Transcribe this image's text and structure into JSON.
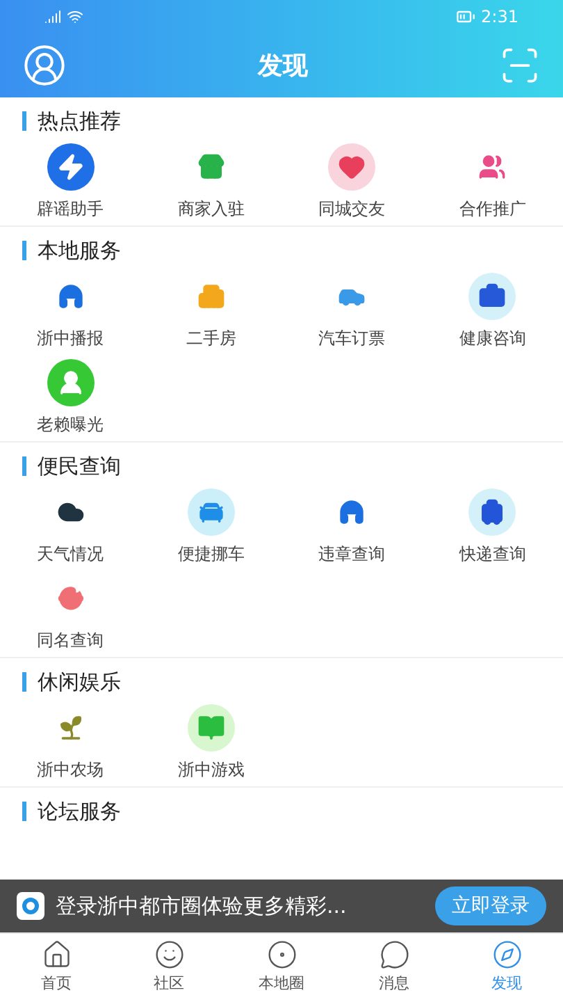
{
  "status_bar": {
    "time": "2:31"
  },
  "header": {
    "title": "发现"
  },
  "sections": [
    {
      "title": "热点推荐",
      "items": [
        "辟谣助手",
        "商家入驻",
        "同城交友",
        "合作推广"
      ]
    },
    {
      "title": "本地服务",
      "items": [
        "浙中播报",
        "二手房",
        "汽车订票",
        "健康咨询",
        "老赖曝光"
      ]
    },
    {
      "title": "便民查询",
      "items": [
        "天气情况",
        "便捷挪车",
        "违章查询",
        "快递查询",
        "同名查询"
      ]
    },
    {
      "title": "休闲娱乐",
      "items": [
        "浙中农场",
        "浙中游戏"
      ]
    },
    {
      "title": "论坛服务"
    }
  ],
  "login_banner": {
    "text": "登录浙中都市圈体验更多精彩...",
    "button": "立即登录"
  },
  "tab_bar": [
    {
      "label": "首页",
      "selected": false
    },
    {
      "label": "社区",
      "selected": false
    },
    {
      "label": "本地圈",
      "selected": false
    },
    {
      "label": "消息",
      "selected": false
    },
    {
      "label": "发现",
      "selected": true
    }
  ]
}
